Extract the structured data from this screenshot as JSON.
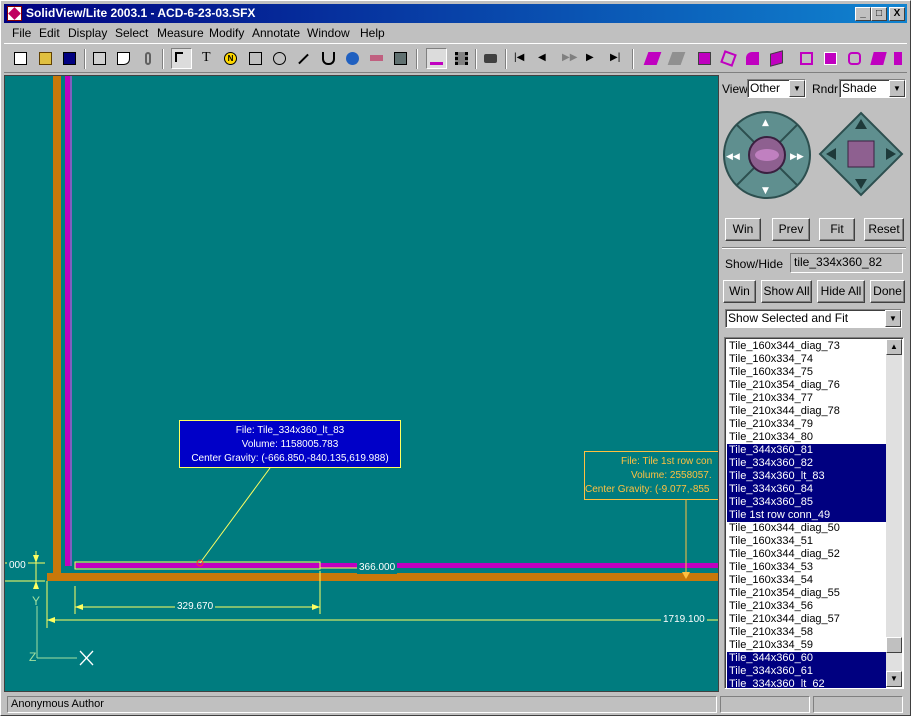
{
  "window": {
    "title": "SolidView/Lite 2003.1 - ACD-6-23-03.SFX",
    "minimize": "_",
    "maximize": "□",
    "close": "X"
  },
  "menu": [
    "File",
    "Edit",
    "Display",
    "Select",
    "Measure",
    "Modify",
    "Annotate",
    "Window",
    "Help"
  ],
  "toolbar": {
    "tools": [
      "new-file-icon",
      "open-file-icon",
      "save-icon",
      "print-icon",
      "print-preview-icon",
      "attach-icon",
      "select-arrow-icon",
      "text-icon",
      "note-icon",
      "rectangle-icon",
      "ellipse-icon",
      "line-icon",
      "lasso-icon",
      "globe-icon",
      "frame-icon",
      "panel-icon",
      "split-view-icon",
      "film-icon",
      "camera-icon",
      "first-frame-icon",
      "prev-frame-icon",
      "fast-forward-icon",
      "next-frame-icon",
      "last-frame-icon",
      "section-1-icon",
      "section-2-icon",
      "section-3-icon",
      "section-4-icon",
      "section-5-icon",
      "section-6-icon",
      "section-7-icon",
      "section-8-icon",
      "section-9-icon",
      "section-10-icon",
      "section-11-icon"
    ],
    "text_tool": "T",
    "note_tool": "N"
  },
  "viewport": {
    "callout_blue": {
      "file": "File: Tile_334x360_lt_83",
      "volume": "Volume: 1158005.783",
      "center": "Center Gravity: (-666.850,-840.135,619.988)"
    },
    "callout_gold": {
      "file": "File: Tile 1st row con",
      "volume": "Volume: 2558057.",
      "center": "Center Gravity: (-9.077,-855"
    },
    "dimensions": {
      "small": "000",
      "d366": "366.000",
      "d329": "329.670",
      "d1719": "1719.100"
    },
    "axes": {
      "y": "Y",
      "z": "Z"
    },
    "colors": {
      "background": "#007c7f",
      "beam": "#c8780a",
      "magenta": "#c000c0",
      "dim": "#ffff60"
    }
  },
  "panel": {
    "view_label": "View",
    "view_value": "Other",
    "render_label": "Rndr",
    "render_value": "Shade",
    "nav_buttons": [
      "Win",
      "Prev",
      "Fit",
      "Reset"
    ],
    "showhide_label": "Show/Hide",
    "showhide_value": "tile_334x360_82",
    "sh_buttons": [
      "Win",
      "Show All",
      "Hide All",
      "Done"
    ],
    "mode_value": "Show Selected and Fit",
    "items": [
      {
        "label": "Tile_160x344_diag_73",
        "selected": false
      },
      {
        "label": "Tile_160x334_74",
        "selected": false
      },
      {
        "label": "Tile_160x334_75",
        "selected": false
      },
      {
        "label": "Tile_210x354_diag_76",
        "selected": false
      },
      {
        "label": "Tile_210x334_77",
        "selected": false
      },
      {
        "label": "Tile_210x344_diag_78",
        "selected": false
      },
      {
        "label": "Tile_210x334_79",
        "selected": false
      },
      {
        "label": "Tile_210x334_80",
        "selected": false
      },
      {
        "label": "Tile_344x360_81",
        "selected": true
      },
      {
        "label": "Tile_334x360_82",
        "selected": true
      },
      {
        "label": "Tile_334x360_lt_83",
        "selected": true
      },
      {
        "label": "Tile_334x360_84",
        "selected": true
      },
      {
        "label": "Tile_334x360_85",
        "selected": true
      },
      {
        "label": "Tile 1st row conn_49",
        "selected": true
      },
      {
        "label": "Tile_160x344_diag_50",
        "selected": false
      },
      {
        "label": "Tile_160x334_51",
        "selected": false
      },
      {
        "label": "Tile_160x344_diag_52",
        "selected": false
      },
      {
        "label": "Tile_160x334_53",
        "selected": false
      },
      {
        "label": "Tile_160x334_54",
        "selected": false
      },
      {
        "label": "Tile_210x354_diag_55",
        "selected": false
      },
      {
        "label": "Tile_210x334_56",
        "selected": false
      },
      {
        "label": "Tile_210x344_diag_57",
        "selected": false
      },
      {
        "label": "Tile_210x334_58",
        "selected": false
      },
      {
        "label": "Tile_210x334_59",
        "selected": false
      },
      {
        "label": "Tile_344x360_60",
        "selected": true
      },
      {
        "label": "Tile_334x360_61",
        "selected": true
      },
      {
        "label": "Tile_334x360_lt_62",
        "selected": true
      }
    ]
  },
  "status": {
    "author": "Anonymous Author"
  }
}
